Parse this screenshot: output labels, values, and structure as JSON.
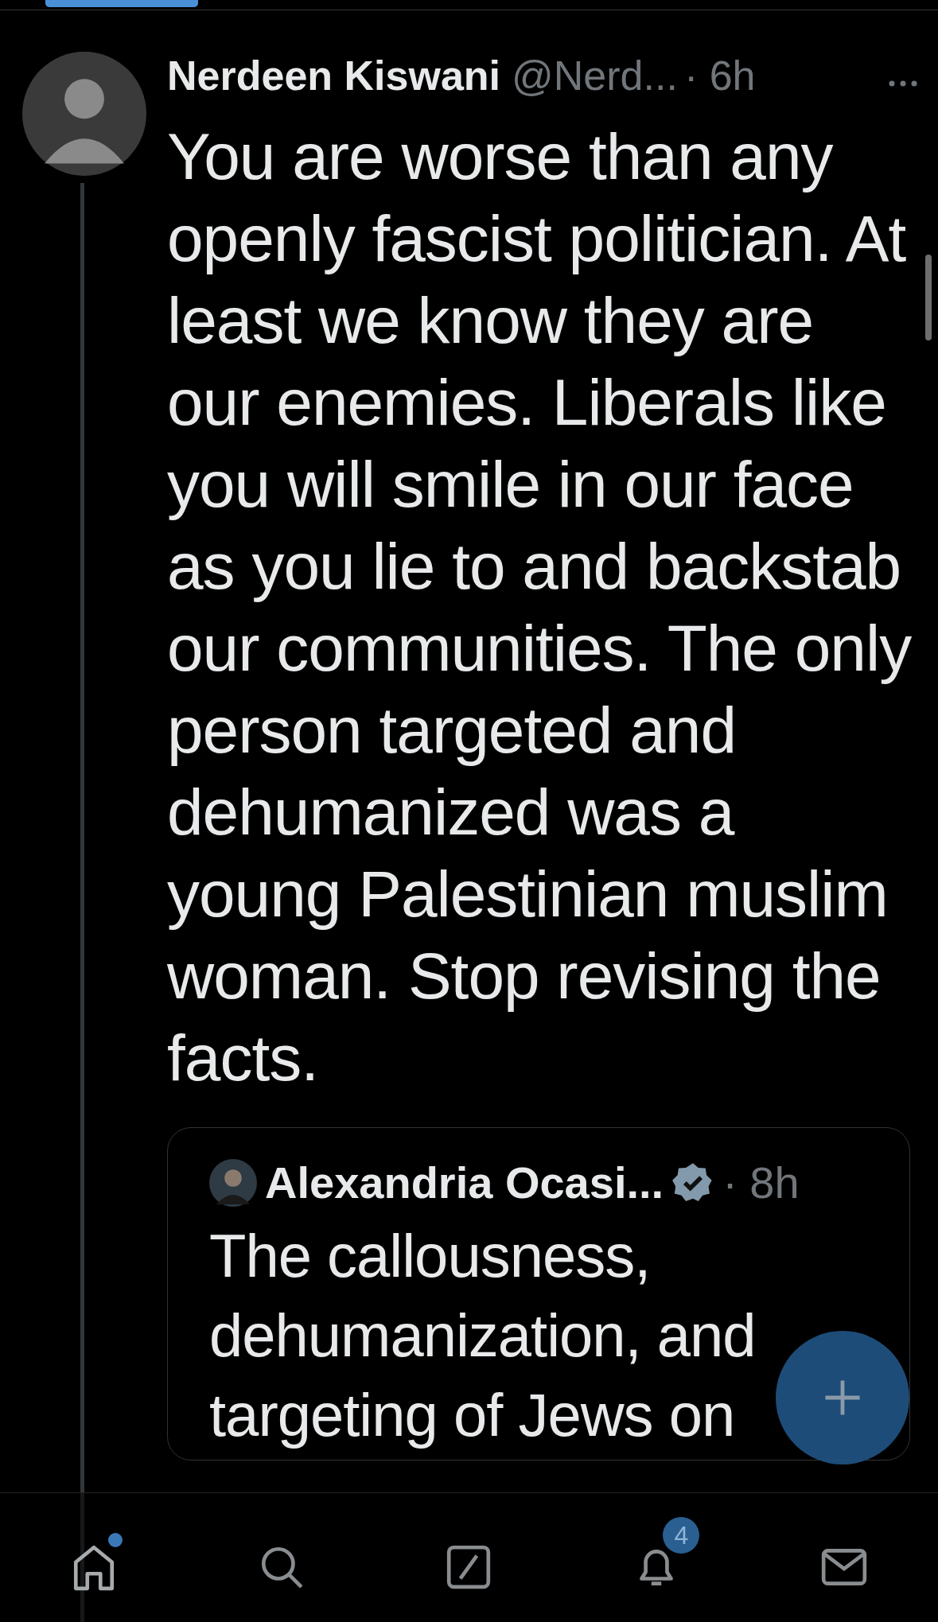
{
  "tweet": {
    "author": "Nerdeen Kiswani",
    "handle": "@Nerd...",
    "time": "· 6h",
    "text": "You are worse than any openly fascist politician. At least we know they are our enemies. Liberals like you will smile in our face as you lie to and backstab our communities. The only person targeted and dehumanized was a young Palestinian muslim woman. Stop revising the facts.",
    "quote": {
      "author": "Alexandria Ocasi...",
      "verified": true,
      "time": "· 8h",
      "text": "The callousness, dehumanization, and targeting of Jews on"
    }
  },
  "nav": [
    {
      "kind": "home",
      "selected": true,
      "unread": true
    },
    {
      "kind": "search",
      "selected": false,
      "unread": false
    },
    {
      "kind": "compose",
      "selected": false,
      "unread": false
    },
    {
      "kind": "notifications",
      "selected": false,
      "unread": false,
      "badge": "4"
    },
    {
      "kind": "messages",
      "selected": false,
      "unread": false
    }
  ]
}
